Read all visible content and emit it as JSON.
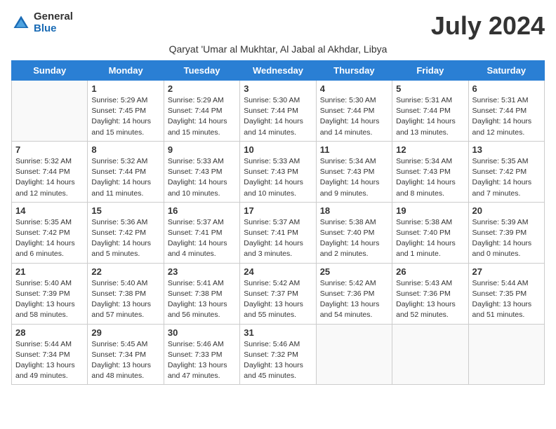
{
  "logo": {
    "general": "General",
    "blue": "Blue"
  },
  "title": "July 2024",
  "location": "Qaryat 'Umar al Mukhtar, Al Jabal al Akhdar, Libya",
  "headers": [
    "Sunday",
    "Monday",
    "Tuesday",
    "Wednesday",
    "Thursday",
    "Friday",
    "Saturday"
  ],
  "weeks": [
    [
      {
        "day": "",
        "info": ""
      },
      {
        "day": "1",
        "info": "Sunrise: 5:29 AM\nSunset: 7:45 PM\nDaylight: 14 hours\nand 15 minutes."
      },
      {
        "day": "2",
        "info": "Sunrise: 5:29 AM\nSunset: 7:44 PM\nDaylight: 14 hours\nand 15 minutes."
      },
      {
        "day": "3",
        "info": "Sunrise: 5:30 AM\nSunset: 7:44 PM\nDaylight: 14 hours\nand 14 minutes."
      },
      {
        "day": "4",
        "info": "Sunrise: 5:30 AM\nSunset: 7:44 PM\nDaylight: 14 hours\nand 14 minutes."
      },
      {
        "day": "5",
        "info": "Sunrise: 5:31 AM\nSunset: 7:44 PM\nDaylight: 14 hours\nand 13 minutes."
      },
      {
        "day": "6",
        "info": "Sunrise: 5:31 AM\nSunset: 7:44 PM\nDaylight: 14 hours\nand 12 minutes."
      }
    ],
    [
      {
        "day": "7",
        "info": "Sunrise: 5:32 AM\nSunset: 7:44 PM\nDaylight: 14 hours\nand 12 minutes."
      },
      {
        "day": "8",
        "info": "Sunrise: 5:32 AM\nSunset: 7:44 PM\nDaylight: 14 hours\nand 11 minutes."
      },
      {
        "day": "9",
        "info": "Sunrise: 5:33 AM\nSunset: 7:43 PM\nDaylight: 14 hours\nand 10 minutes."
      },
      {
        "day": "10",
        "info": "Sunrise: 5:33 AM\nSunset: 7:43 PM\nDaylight: 14 hours\nand 10 minutes."
      },
      {
        "day": "11",
        "info": "Sunrise: 5:34 AM\nSunset: 7:43 PM\nDaylight: 14 hours\nand 9 minutes."
      },
      {
        "day": "12",
        "info": "Sunrise: 5:34 AM\nSunset: 7:43 PM\nDaylight: 14 hours\nand 8 minutes."
      },
      {
        "day": "13",
        "info": "Sunrise: 5:35 AM\nSunset: 7:42 PM\nDaylight: 14 hours\nand 7 minutes."
      }
    ],
    [
      {
        "day": "14",
        "info": "Sunrise: 5:35 AM\nSunset: 7:42 PM\nDaylight: 14 hours\nand 6 minutes."
      },
      {
        "day": "15",
        "info": "Sunrise: 5:36 AM\nSunset: 7:42 PM\nDaylight: 14 hours\nand 5 minutes."
      },
      {
        "day": "16",
        "info": "Sunrise: 5:37 AM\nSunset: 7:41 PM\nDaylight: 14 hours\nand 4 minutes."
      },
      {
        "day": "17",
        "info": "Sunrise: 5:37 AM\nSunset: 7:41 PM\nDaylight: 14 hours\nand 3 minutes."
      },
      {
        "day": "18",
        "info": "Sunrise: 5:38 AM\nSunset: 7:40 PM\nDaylight: 14 hours\nand 2 minutes."
      },
      {
        "day": "19",
        "info": "Sunrise: 5:38 AM\nSunset: 7:40 PM\nDaylight: 14 hours\nand 1 minute."
      },
      {
        "day": "20",
        "info": "Sunrise: 5:39 AM\nSunset: 7:39 PM\nDaylight: 14 hours\nand 0 minutes."
      }
    ],
    [
      {
        "day": "21",
        "info": "Sunrise: 5:40 AM\nSunset: 7:39 PM\nDaylight: 13 hours\nand 58 minutes."
      },
      {
        "day": "22",
        "info": "Sunrise: 5:40 AM\nSunset: 7:38 PM\nDaylight: 13 hours\nand 57 minutes."
      },
      {
        "day": "23",
        "info": "Sunrise: 5:41 AM\nSunset: 7:38 PM\nDaylight: 13 hours\nand 56 minutes."
      },
      {
        "day": "24",
        "info": "Sunrise: 5:42 AM\nSunset: 7:37 PM\nDaylight: 13 hours\nand 55 minutes."
      },
      {
        "day": "25",
        "info": "Sunrise: 5:42 AM\nSunset: 7:36 PM\nDaylight: 13 hours\nand 54 minutes."
      },
      {
        "day": "26",
        "info": "Sunrise: 5:43 AM\nSunset: 7:36 PM\nDaylight: 13 hours\nand 52 minutes."
      },
      {
        "day": "27",
        "info": "Sunrise: 5:44 AM\nSunset: 7:35 PM\nDaylight: 13 hours\nand 51 minutes."
      }
    ],
    [
      {
        "day": "28",
        "info": "Sunrise: 5:44 AM\nSunset: 7:34 PM\nDaylight: 13 hours\nand 49 minutes."
      },
      {
        "day": "29",
        "info": "Sunrise: 5:45 AM\nSunset: 7:34 PM\nDaylight: 13 hours\nand 48 minutes."
      },
      {
        "day": "30",
        "info": "Sunrise: 5:46 AM\nSunset: 7:33 PM\nDaylight: 13 hours\nand 47 minutes."
      },
      {
        "day": "31",
        "info": "Sunrise: 5:46 AM\nSunset: 7:32 PM\nDaylight: 13 hours\nand 45 minutes."
      },
      {
        "day": "",
        "info": ""
      },
      {
        "day": "",
        "info": ""
      },
      {
        "day": "",
        "info": ""
      }
    ]
  ]
}
